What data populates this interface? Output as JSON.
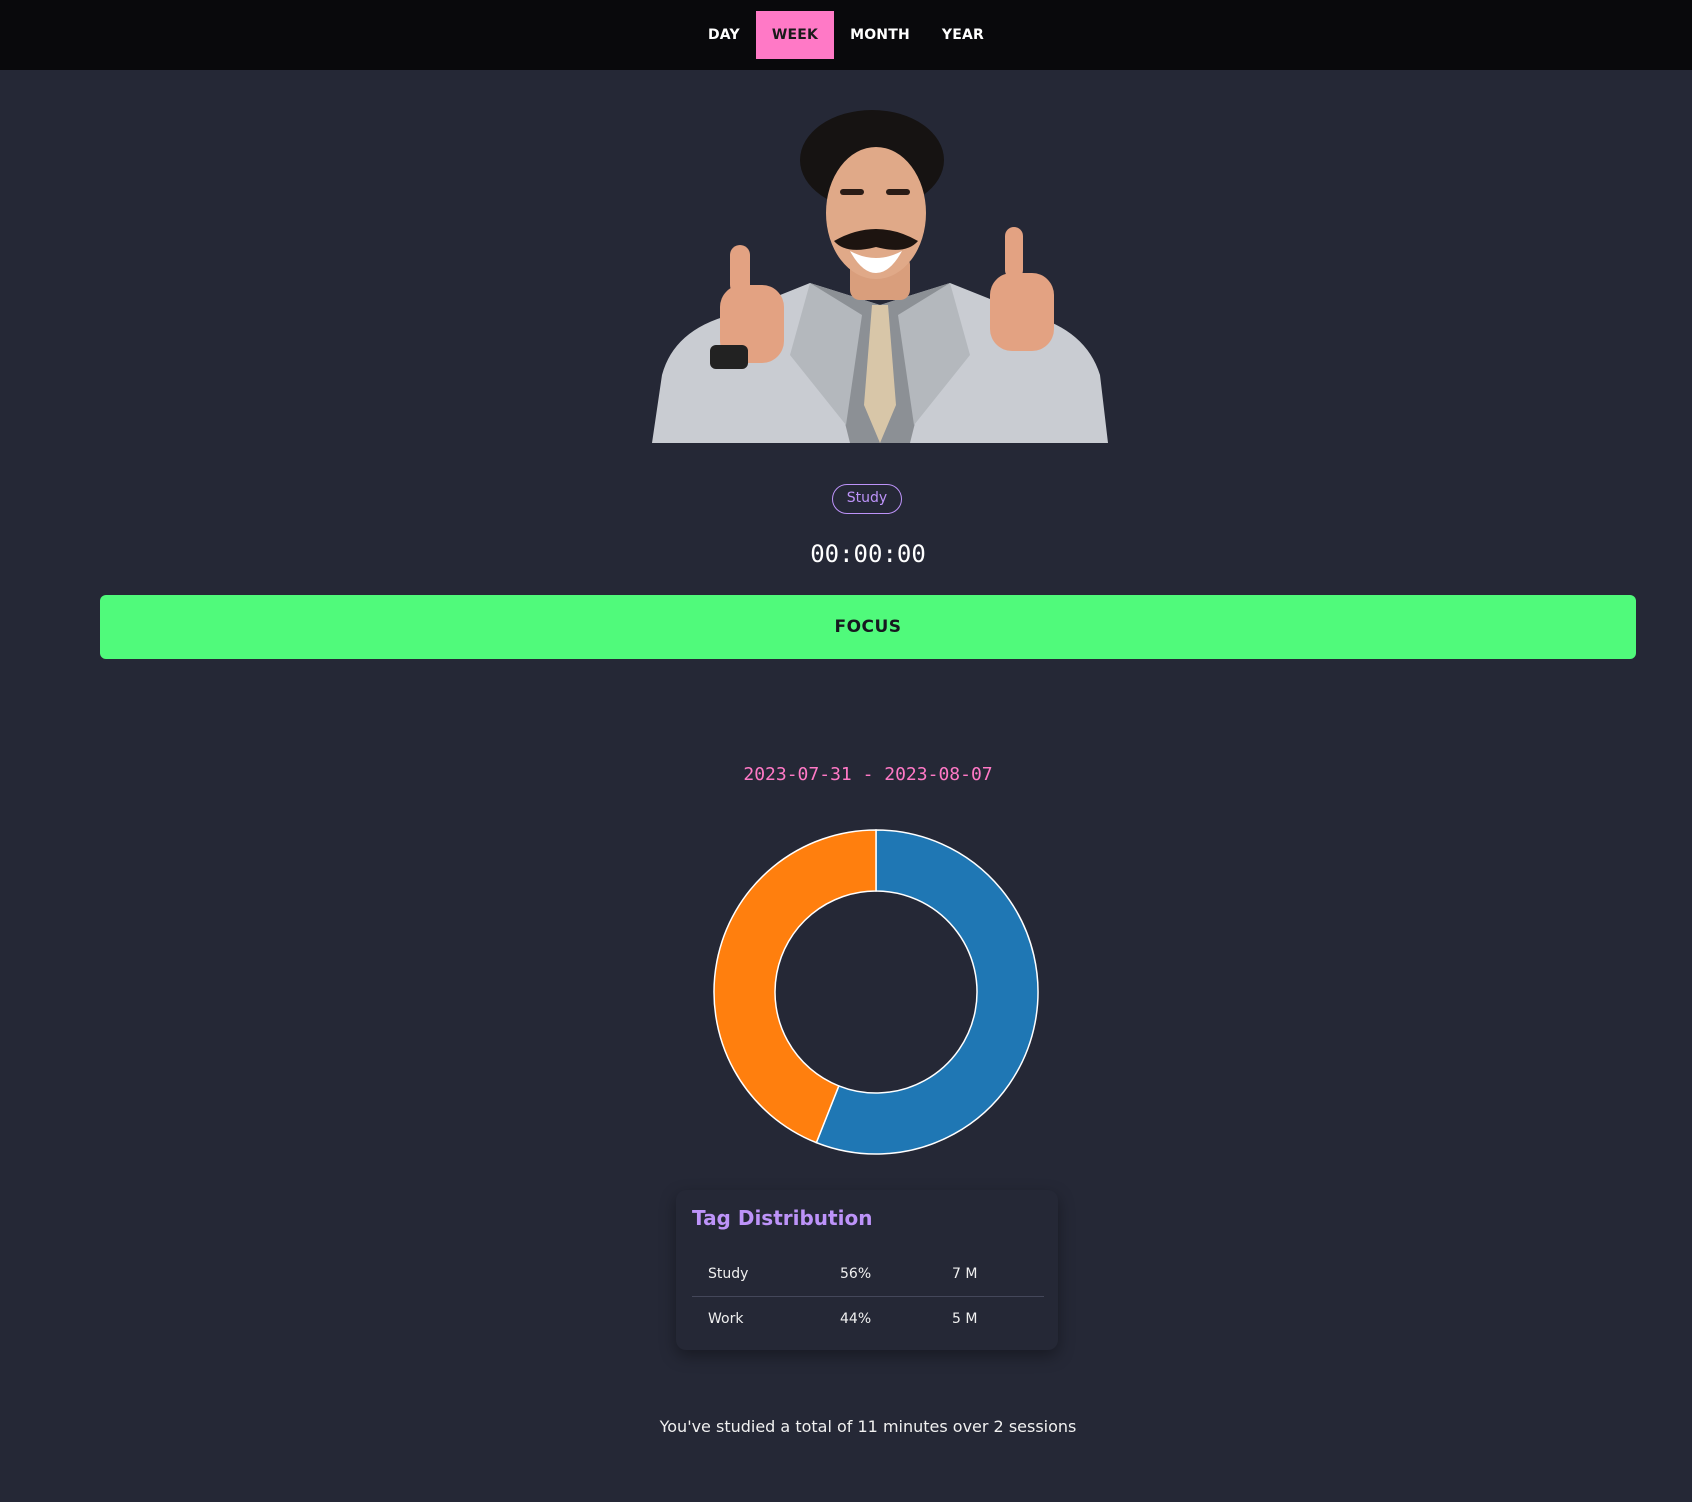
{
  "nav": {
    "tabs": [
      {
        "label": "DAY",
        "active": false
      },
      {
        "label": "WEEK",
        "active": true
      },
      {
        "label": "MONTH",
        "active": false
      },
      {
        "label": "YEAR",
        "active": false
      }
    ]
  },
  "tag": {
    "label": "Study"
  },
  "timer": {
    "value": "00:00:00"
  },
  "focus_button": {
    "label": "FOCUS"
  },
  "date_range": "2023-07-31 - 2023-08-07",
  "chart_data": {
    "type": "pie",
    "donut": true,
    "categories": [
      "Study",
      "Work"
    ],
    "values": [
      56,
      44
    ],
    "colors": [
      "#1f77b4",
      "#ff7f0e"
    ]
  },
  "distribution": {
    "title": "Tag Distribution",
    "rows": [
      {
        "name": "Study",
        "percent": "56%",
        "duration": "7 M"
      },
      {
        "name": "Work",
        "percent": "44%",
        "duration": "5 M"
      }
    ]
  },
  "summary": "You've studied a total of 11 minutes over 2 sessions",
  "colors": {
    "background": "#252836",
    "topbar": "#09090c",
    "accent_pink": "#ff79c6",
    "accent_purple": "#bd93f9",
    "focus_green": "#50fa7b"
  }
}
